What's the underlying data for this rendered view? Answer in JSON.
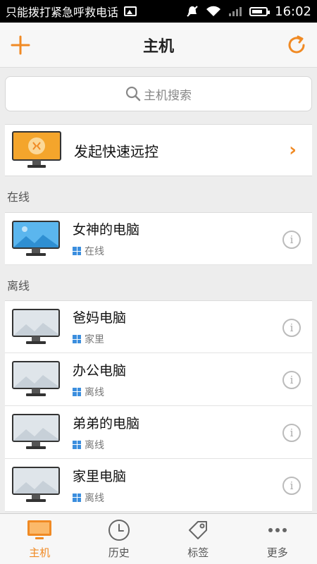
{
  "status_bar": {
    "carrier_text": "只能拨打紧急呼救电话",
    "time": "16:02"
  },
  "header": {
    "title": "主机",
    "accent_color": "#f08a24"
  },
  "search": {
    "placeholder": "主机搜索"
  },
  "quick_connect": {
    "label": "发起快速远控"
  },
  "sections": {
    "online": "在线",
    "offline": "离线"
  },
  "online_hosts": [
    {
      "name": "女神的电脑",
      "status": "在线"
    }
  ],
  "offline_hosts": [
    {
      "name": "爸妈电脑",
      "status": "家里"
    },
    {
      "name": "办公电脑",
      "status": "离线"
    },
    {
      "name": "弟弟的电脑",
      "status": "离线"
    },
    {
      "name": "家里电脑",
      "status": "离线"
    }
  ],
  "tabs": [
    {
      "label": "主机",
      "icon": "monitor-icon",
      "active": true
    },
    {
      "label": "历史",
      "icon": "clock-icon",
      "active": false
    },
    {
      "label": "标签",
      "icon": "tag-icon",
      "active": false
    },
    {
      "label": "更多",
      "icon": "more-icon",
      "active": false
    }
  ]
}
